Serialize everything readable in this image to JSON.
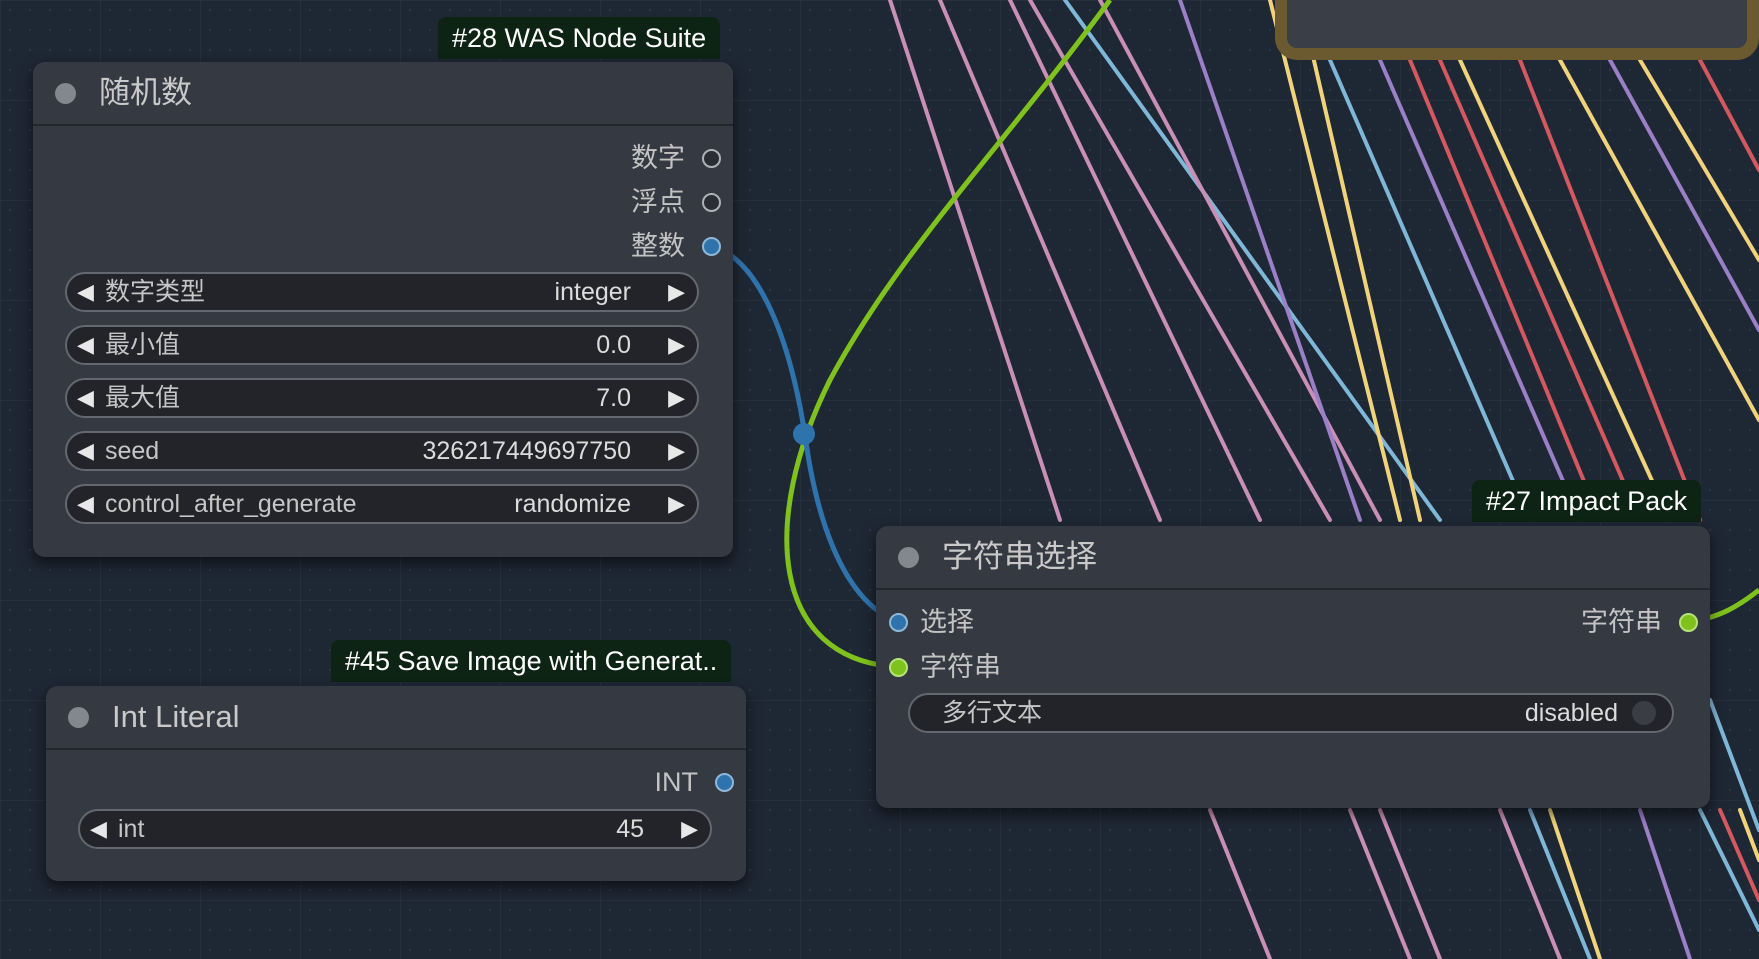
{
  "nodes": {
    "random": {
      "badge": "#28 WAS Node Suite",
      "title": "随机数",
      "outputs": [
        "数字",
        "浮点",
        "整数"
      ],
      "widgets": [
        {
          "label": "数字类型",
          "value": "integer"
        },
        {
          "label": "最小值",
          "value": "0.0"
        },
        {
          "label": "最大值",
          "value": "7.0"
        },
        {
          "label": "seed",
          "value": "326217449697750"
        },
        {
          "label": "control_after_generate",
          "value": "randomize"
        }
      ]
    },
    "int_literal": {
      "badge": "#45 Save Image with Generat..",
      "title": "Int Literal",
      "output": "INT",
      "widget": {
        "label": "int",
        "value": "45"
      }
    },
    "string_select": {
      "badge": "#27 Impact Pack",
      "title": "字符串选择",
      "inputs": [
        "选择",
        "字符串"
      ],
      "output": "字符串",
      "widget": {
        "label": "多行文本",
        "value": "disabled"
      }
    }
  },
  "arrows": {
    "left": "◀",
    "right": "▶"
  },
  "colors": {
    "canvas": "#1e2734",
    "node_body": "#353941",
    "badge_bg": "#0d2414",
    "int_wire": "#2f73ad",
    "string_wire": "#7fc21d",
    "pink_wire": "#c98fb6",
    "yellow_wire": "#f0d37b",
    "red_wire": "#d4585f",
    "lightblue_wire": "#7fb7d8",
    "purple_wire": "#9b7fc7"
  }
}
